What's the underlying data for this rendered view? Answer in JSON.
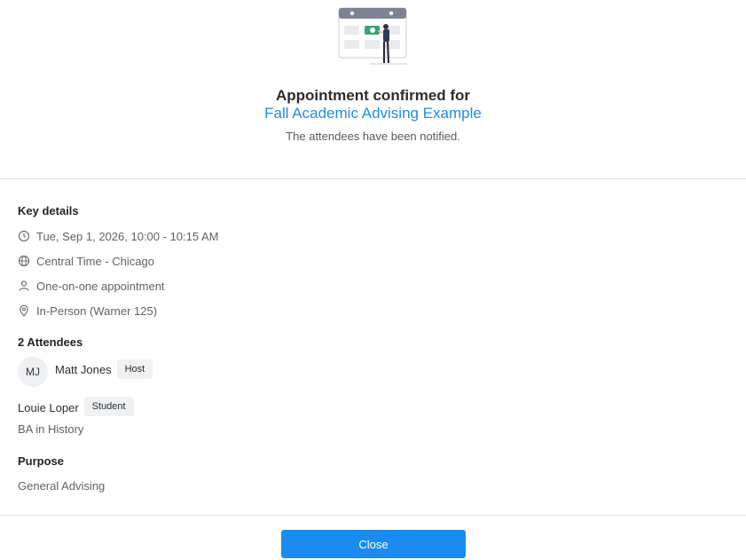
{
  "header": {
    "title_prefix": "Appointment confirmed for",
    "title_event": "Fall Academic Advising Example",
    "notified": "The attendees have been notified."
  },
  "key_details": {
    "heading": "Key details",
    "datetime": "Tue, Sep 1, 2026, 10:00 - 10:15 AM",
    "timezone": "Central Time - Chicago",
    "type": "One-on-one appointment",
    "location": "In-Person (Warner 125)"
  },
  "attendees": {
    "heading": "2 Attendees",
    "host": {
      "initials": "MJ",
      "name": "Matt Jones",
      "role": "Host"
    },
    "student": {
      "name": "Louie Loper",
      "role": "Student",
      "program": "BA in History"
    }
  },
  "purpose": {
    "heading": "Purpose",
    "value": "General Advising"
  },
  "footer": {
    "close_label": "Close"
  },
  "colors": {
    "accent": "#1a8cf0",
    "link": "#1e8ce8",
    "illustration_green": "#3aa371",
    "illustration_header": "#7d8294"
  },
  "icons": [
    "clock-icon",
    "globe-icon",
    "person-icon",
    "location-pin-icon"
  ]
}
